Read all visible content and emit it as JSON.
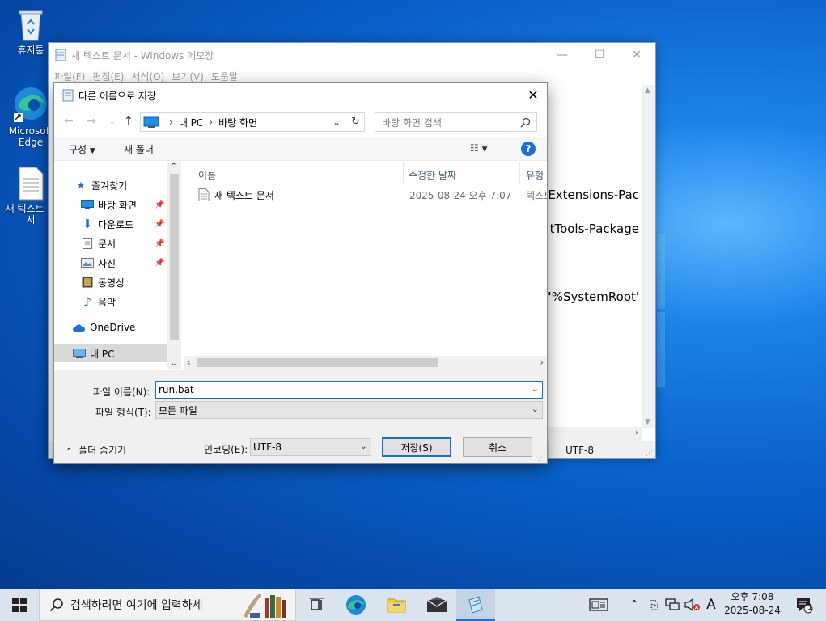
{
  "desktop": {
    "icons": [
      {
        "label": "휴지통"
      },
      {
        "label": "Microsoft Edge"
      },
      {
        "label": "새 텍스트 문서"
      }
    ]
  },
  "notepad": {
    "title": "새 텍스트 문서 - Windows 메모장",
    "menu": [
      "파일(F)",
      "편집(E)",
      "서식(O)",
      "보기(V)",
      "도움말"
    ],
    "visible_text_fragments": [
      "tExtensions-Pac",
      "tTools-Package",
      ":\"%SystemRoot'"
    ],
    "status_encoding": "UTF-8"
  },
  "dialog": {
    "title": "다른 이름으로 저장",
    "close_symbol": "✕",
    "address_path": [
      "내 PC",
      "바탕 화면"
    ],
    "search_placeholder": "바탕 화면 검색",
    "toolbar": {
      "organize": "구성",
      "new_folder": "새 폴더",
      "help": "?"
    },
    "nav": {
      "quick_access": "즐겨찾기",
      "items": [
        {
          "label": "바탕 화면",
          "pinned": true
        },
        {
          "label": "다운로드",
          "pinned": true
        },
        {
          "label": "문서",
          "pinned": true
        },
        {
          "label": "사진",
          "pinned": true
        },
        {
          "label": "동영상",
          "pinned": false
        },
        {
          "label": "음악",
          "pinned": false
        }
      ],
      "onedrive": "OneDrive",
      "this_pc": "내 PC"
    },
    "columns": {
      "name": "이름",
      "modified": "수정한 날짜",
      "type": "유형"
    },
    "files": [
      {
        "name": "새 텍스트 문서",
        "modified": "2025-08-24 오후 7:07",
        "type": "텍스트 문서"
      }
    ],
    "filename_label": "파일 이름(N):",
    "filename_value": "run.bat",
    "filetype_label": "파일 형식(T):",
    "filetype_value": "모든 파일",
    "hide_folders": "폴더 숨기기",
    "encoding_label": "인코딩(E):",
    "encoding_value": "UTF-8",
    "save_button": "저장(S)",
    "cancel_button": "취소"
  },
  "taskbar": {
    "search_placeholder": "검색하려면 여기에 입력하세",
    "ime_indicator": "A",
    "clock_time": "오후 7:08",
    "clock_date": "2025-08-24",
    "notification_count": "1"
  }
}
